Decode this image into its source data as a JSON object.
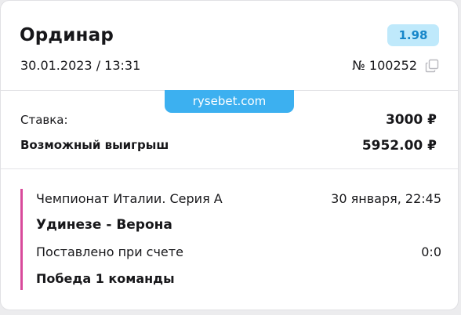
{
  "bet": {
    "title": "Ординар",
    "coefficient": "1.98",
    "datetime": "30.01.2023 / 13:31",
    "number": "№ 100252"
  },
  "watermark": "rysebet.com",
  "stake": {
    "label": "Ставка:",
    "value": "3000 ₽"
  },
  "winnings": {
    "label": "Возможный выигрыш",
    "value": "5952.00 ₽"
  },
  "event": {
    "league": "Чемпионат Италии. Серия А",
    "date": "30 января, 22:45",
    "match": "Удинезе - Верона",
    "score_label": "Поставлено при счете",
    "score": "0:0",
    "outcome": "Победа 1 команды"
  },
  "colors": {
    "badge_bg": "#bfe9fb",
    "badge_text": "#1686c9",
    "watermark_bg": "#3cb0f0",
    "event_accent": "#d84a9b"
  },
  "icons": {
    "copy": "copy-icon"
  }
}
